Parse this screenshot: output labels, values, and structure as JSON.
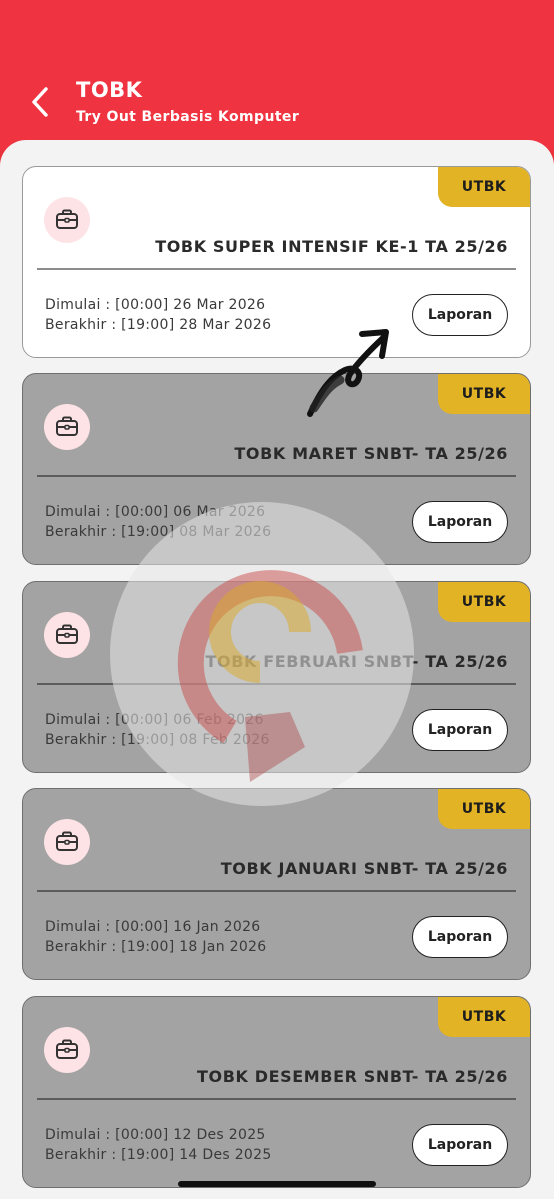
{
  "header": {
    "title": "TOBK",
    "subtitle": "Try Out Berbasis Komputer"
  },
  "colors": {
    "header_bg": "#ef3340",
    "badge_bg": "#e2b325",
    "active_card_bg": "#ffffff",
    "inactive_card_bg": "#a3a3a3"
  },
  "cards": [
    {
      "badge": "UTBK",
      "title": "TOBK SUPER INTENSIF KE-1 TA 25/26",
      "start": "Dimulai : [00:00] 26 Mar 2026",
      "end": "Berakhir : [19:00] 28 Mar 2026",
      "button": "Laporan",
      "icon": "briefcase-icon"
    },
    {
      "badge": "UTBK",
      "title": "TOBK MARET SNBT- TA 25/26",
      "start": "Dimulai : [00:00] 06 Mar 2026",
      "end": "Berakhir : [19:00] 08 Mar 2026",
      "button": "Laporan",
      "icon": "briefcase-icon"
    },
    {
      "badge": "UTBK",
      "title": "TOBK FEBRUARI SNBT- TA 25/26",
      "start": "Dimulai : [00:00] 06 Feb 2026",
      "end": "Berakhir : [19:00] 08 Feb 2026",
      "button": "Laporan",
      "icon": "briefcase-icon"
    },
    {
      "badge": "UTBK",
      "title": "TOBK JANUARI SNBT- TA 25/26",
      "start": "Dimulai : [00:00] 16 Jan 2026",
      "end": "Berakhir : [19:00] 18 Jan 2026",
      "button": "Laporan",
      "icon": "briefcase-icon"
    },
    {
      "badge": "UTBK",
      "title": "TOBK DESEMBER SNBT- TA 25/26",
      "start": "Dimulai : [00:00] 12 Des 2025",
      "end": "Berakhir : [19:00] 14 Des 2025",
      "button": "Laporan",
      "icon": "briefcase-icon"
    }
  ]
}
